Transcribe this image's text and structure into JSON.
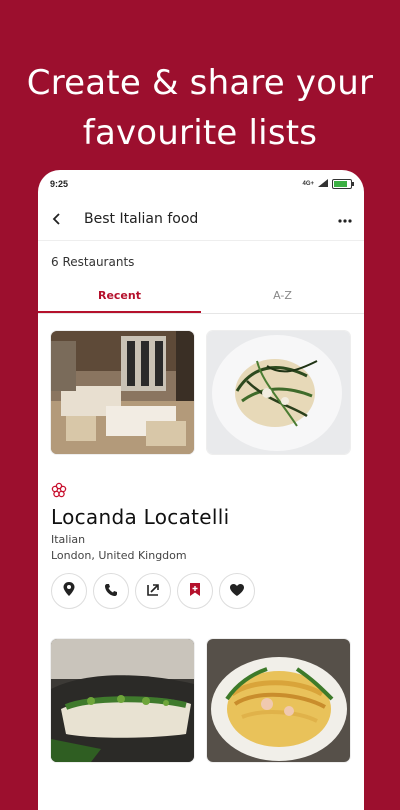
{
  "promo": {
    "line1": "Create & share your",
    "line2": "favourite lists"
  },
  "status": {
    "time": "9:25",
    "signal": "4G+"
  },
  "appbar": {
    "title": "Best Italian food"
  },
  "list": {
    "count": "6 Restaurants"
  },
  "tabs": [
    {
      "label": "Recent"
    },
    {
      "label": "A-Z"
    }
  ],
  "restaurant": {
    "name": "Locanda Locatelli",
    "cuisine": "Italian",
    "location": "London, United Kingdom",
    "actions": [
      {
        "icon": "location-pin-icon"
      },
      {
        "icon": "phone-icon"
      },
      {
        "icon": "open-external-icon"
      },
      {
        "icon": "bookmark-add-icon"
      },
      {
        "icon": "heart-icon"
      }
    ]
  },
  "colors": {
    "brand": "#9c0f2e",
    "accent": "#b5112c"
  }
}
